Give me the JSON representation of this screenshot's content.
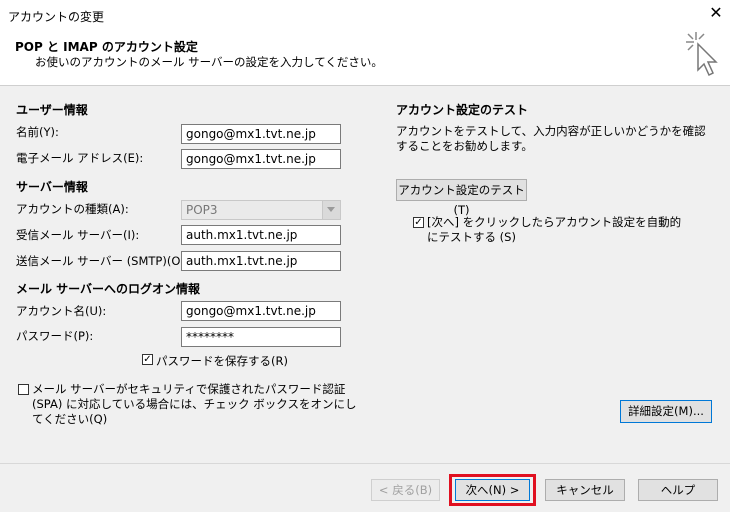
{
  "window": {
    "title": "アカウントの変更",
    "close_glyph": "✕"
  },
  "header": {
    "title": "POP と IMAP のアカウント設定",
    "subtitle": "お使いのアカウントのメール サーバーの設定を入力してください。",
    "icon": "wizard-cursor-icon"
  },
  "user_info": {
    "section": "ユーザー情報",
    "name_label": "名前(Y):",
    "name_value": "gongo@mx1.tvt.ne.jp",
    "email_label": "電子メール アドレス(E):",
    "email_value": "gongo@mx1.tvt.ne.jp"
  },
  "server_info": {
    "section": "サーバー情報",
    "account_type_label": "アカウントの種類(A):",
    "account_type_value": "POP3",
    "incoming_label": "受信メール サーバー(I):",
    "incoming_value": "auth.mx1.tvt.ne.jp",
    "outgoing_label": "送信メール サーバー (SMTP)(O):",
    "outgoing_value": "auth.mx1.tvt.ne.jp"
  },
  "logon_info": {
    "section": "メール サーバーへのログオン情報",
    "account_name_label": "アカウント名(U):",
    "account_name_value": "gongo@mx1.tvt.ne.jp",
    "password_label": "パスワード(P):",
    "password_value": "********",
    "remember_password_label": "パスワードを保存する(R)",
    "remember_password_checked": true,
    "spa_label": "メール サーバーがセキュリティで保護されたパスワード認証 (SPA) に対応している場合には、チェック ボックスをオンにしてください(Q)",
    "spa_checked": false
  },
  "test": {
    "section": "アカウント設定のテスト",
    "description": "アカウントをテストして、入力内容が正しいかどうかを確認することをお勧めします。",
    "test_button": "アカウント設定のテスト(T)",
    "auto_test_label": "[次へ] をクリックしたらアカウント設定を自動的にテストする (S)",
    "auto_test_checked": true
  },
  "advanced_button": "詳細設定(M)...",
  "footer": {
    "back": "< 戻る(B)",
    "next": "次へ(N) >",
    "cancel": "キャンセル",
    "help": "ヘルプ"
  },
  "colors": {
    "highlight": "#e01020",
    "focus": "#0078d7"
  }
}
